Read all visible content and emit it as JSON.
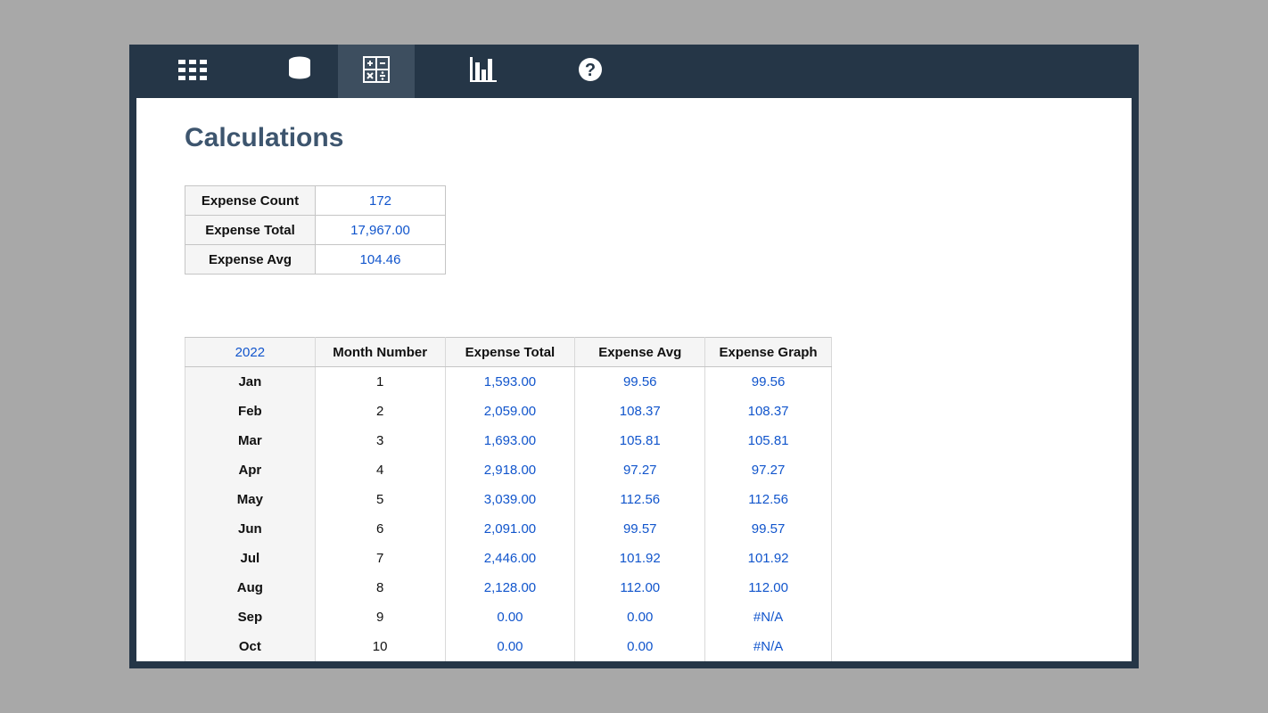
{
  "page": {
    "title": "Calculations"
  },
  "summary": {
    "rows": [
      {
        "label": "Expense Count",
        "value": "172"
      },
      {
        "label": "Expense Total",
        "value": "17,967.00"
      },
      {
        "label": "Expense Avg",
        "value": "104.46"
      }
    ]
  },
  "monthly": {
    "year": "2022",
    "headers": {
      "month_number": "Month Number",
      "expense_total": "Expense Total",
      "expense_avg": "Expense Avg",
      "expense_graph": "Expense Graph"
    },
    "rows": [
      {
        "month": "Jan",
        "num": "1",
        "total": "1,593.00",
        "avg": "99.56",
        "graph": "99.56"
      },
      {
        "month": "Feb",
        "num": "2",
        "total": "2,059.00",
        "avg": "108.37",
        "graph": "108.37"
      },
      {
        "month": "Mar",
        "num": "3",
        "total": "1,693.00",
        "avg": "105.81",
        "graph": "105.81"
      },
      {
        "month": "Apr",
        "num": "4",
        "total": "2,918.00",
        "avg": "97.27",
        "graph": "97.27"
      },
      {
        "month": "May",
        "num": "5",
        "total": "3,039.00",
        "avg": "112.56",
        "graph": "112.56"
      },
      {
        "month": "Jun",
        "num": "6",
        "total": "2,091.00",
        "avg": "99.57",
        "graph": "99.57"
      },
      {
        "month": "Jul",
        "num": "7",
        "total": "2,446.00",
        "avg": "101.92",
        "graph": "101.92"
      },
      {
        "month": "Aug",
        "num": "8",
        "total": "2,128.00",
        "avg": "112.00",
        "graph": "112.00"
      },
      {
        "month": "Sep",
        "num": "9",
        "total": "0.00",
        "avg": "0.00",
        "graph": "#N/A"
      },
      {
        "month": "Oct",
        "num": "10",
        "total": "0.00",
        "avg": "0.00",
        "graph": "#N/A"
      }
    ]
  }
}
